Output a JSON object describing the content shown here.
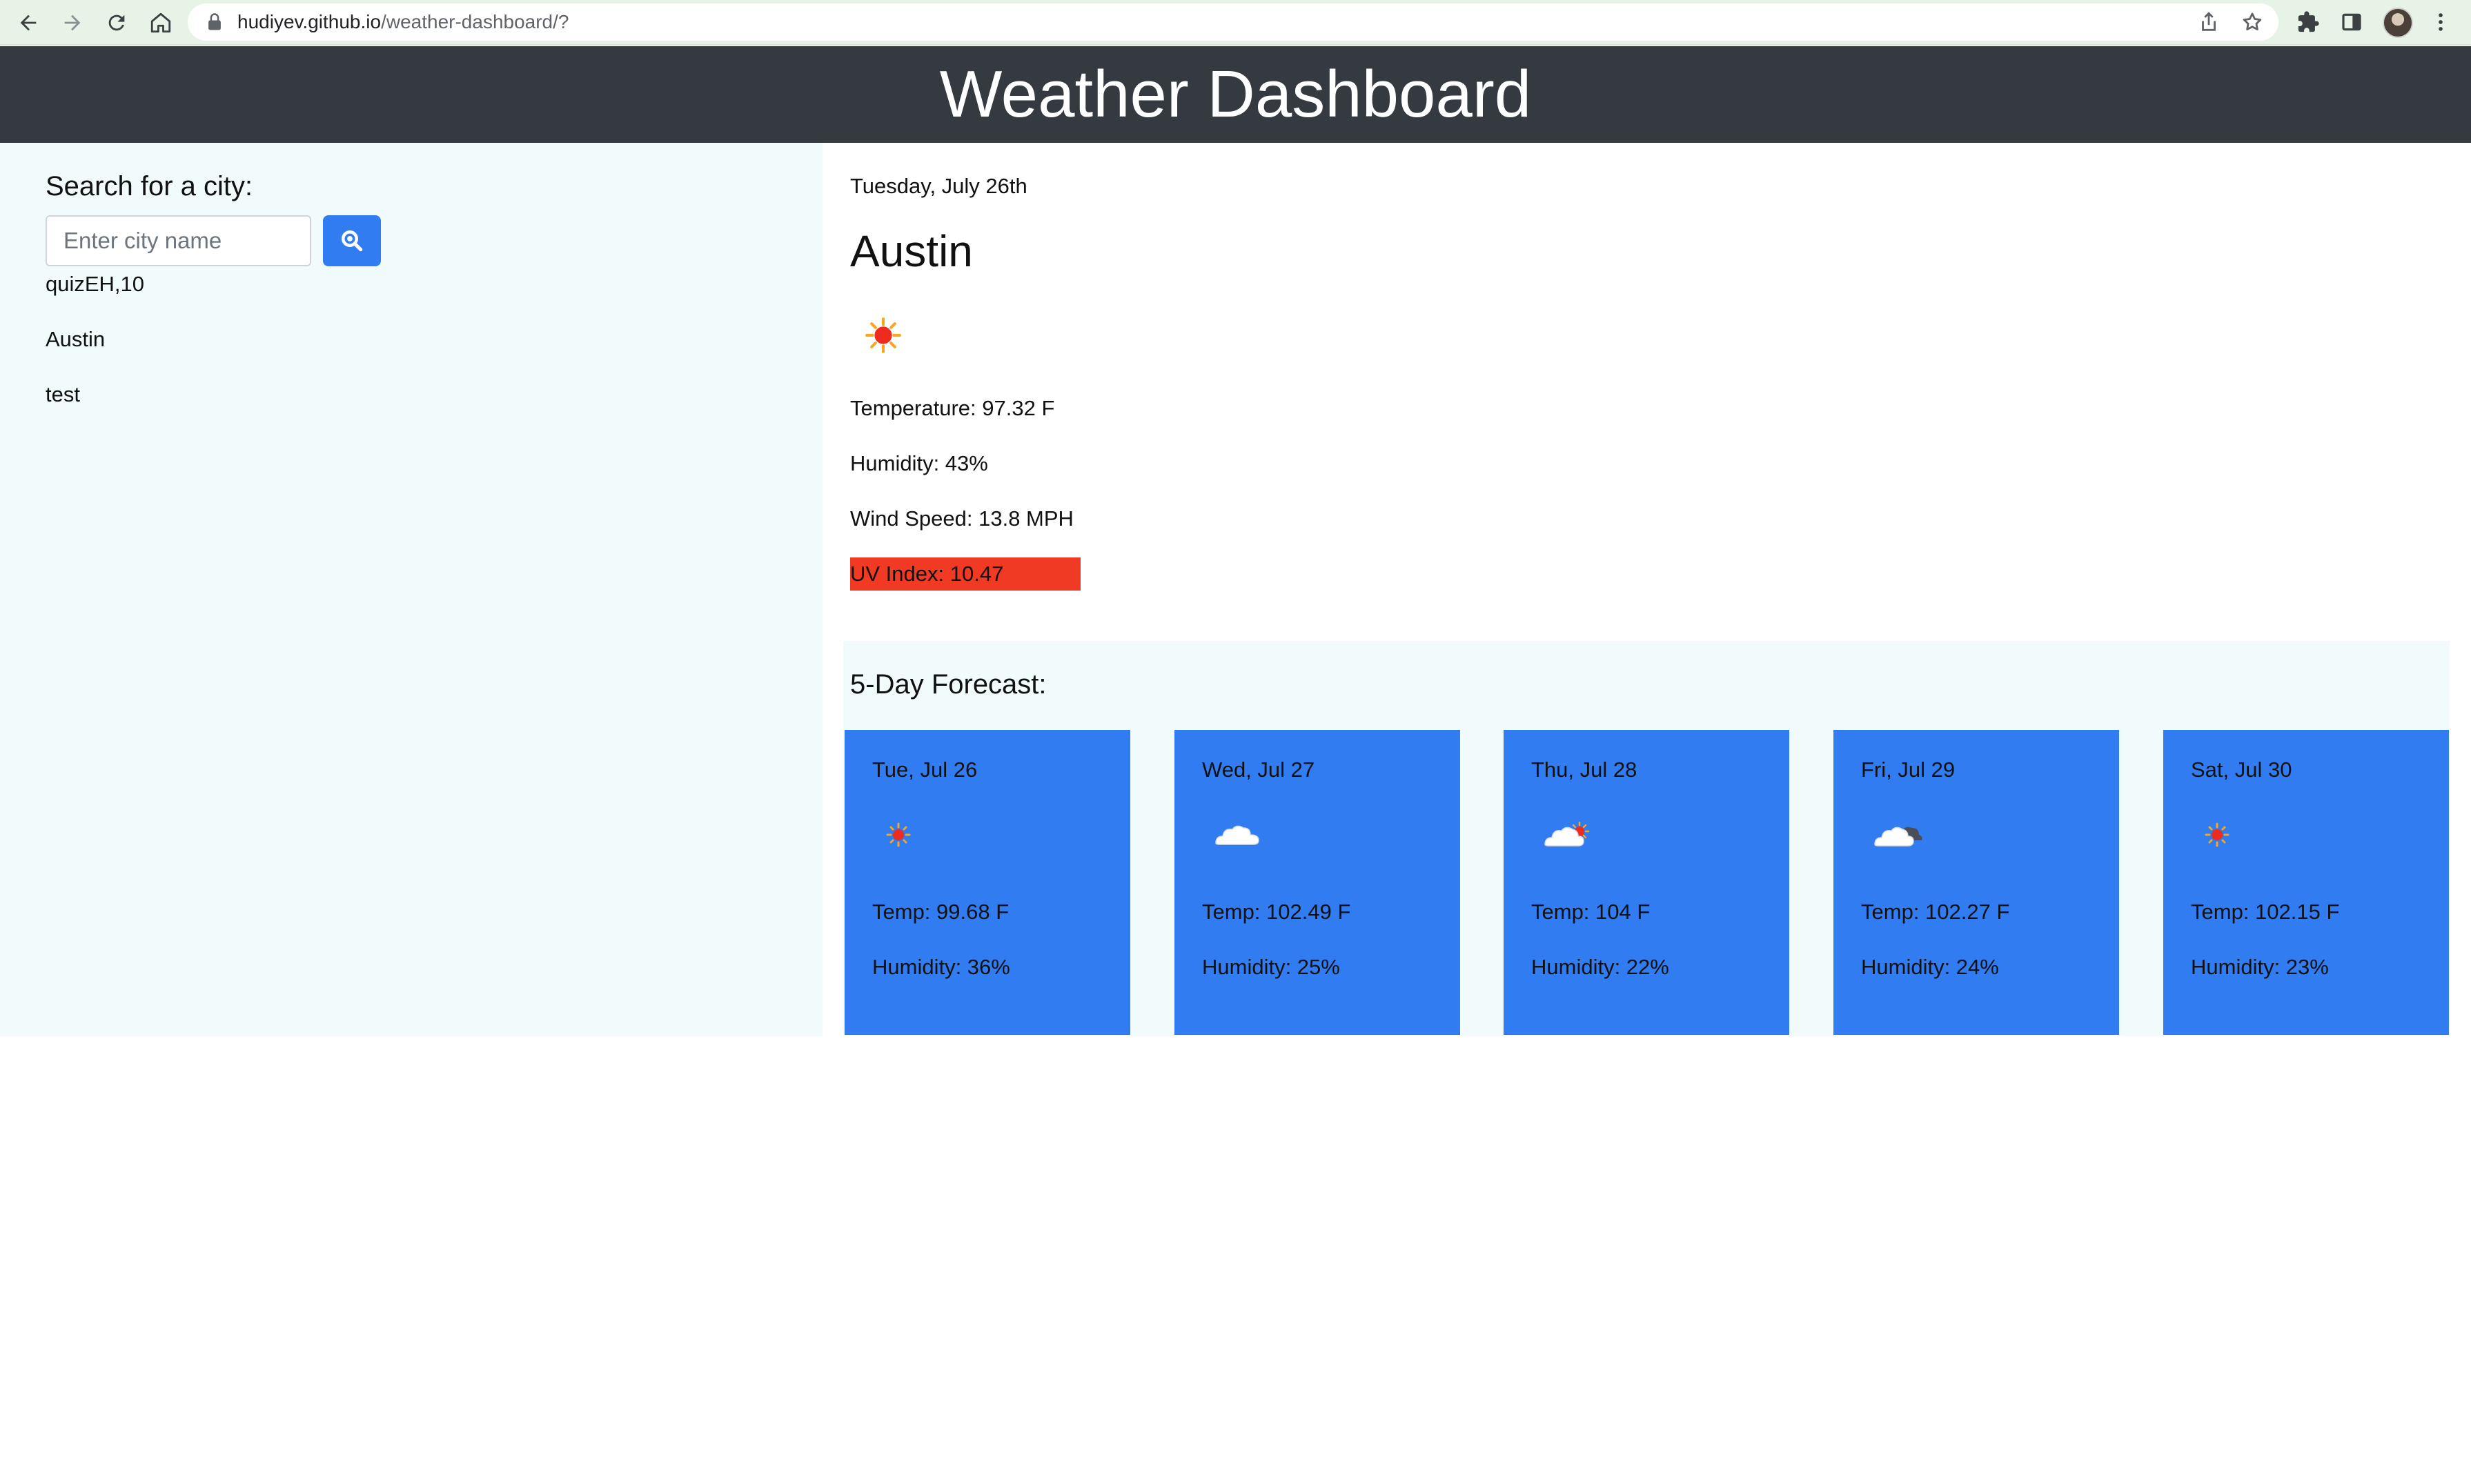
{
  "browser": {
    "url_host": "hudiyev.github.io",
    "url_path": "/weather-dashboard/?"
  },
  "header": {
    "title": "Weather Dashboard"
  },
  "sidebar": {
    "search_label": "Search for a city:",
    "search_placeholder": "Enter city name",
    "search_value": "",
    "search_button_icon": "search-icon",
    "history": [
      "quizEH,10",
      "Austin",
      "test"
    ]
  },
  "current": {
    "date": "Tuesday, July 26th",
    "city": "Austin",
    "icon": "sun-icon",
    "temperature": "Temperature: 97.32 F",
    "humidity": "Humidity: 43%",
    "wind": "Wind Speed: 13.8 MPH",
    "uv": "UV Index: 10.47",
    "uv_color": "#f03a23"
  },
  "forecast": {
    "title": "5-Day Forecast:",
    "card_color": "#307cf0",
    "days": [
      {
        "date": "Tue, Jul 26",
        "icon": "sun-icon",
        "temp": "Temp: 99.68 F",
        "humidity": "Humidity: 36%"
      },
      {
        "date": "Wed, Jul 27",
        "icon": "cloud-icon",
        "temp": "Temp: 102.49 F",
        "humidity": "Humidity: 25%"
      },
      {
        "date": "Thu, Jul 28",
        "icon": "partly-cloudy-icon",
        "temp": "Temp: 104 F",
        "humidity": "Humidity: 22%"
      },
      {
        "date": "Fri, Jul 29",
        "icon": "broken-clouds-icon",
        "temp": "Temp: 102.27 F",
        "humidity": "Humidity: 24%"
      },
      {
        "date": "Sat, Jul 30",
        "icon": "sun-icon",
        "temp": "Temp: 102.15 F",
        "humidity": "Humidity: 23%"
      }
    ]
  }
}
